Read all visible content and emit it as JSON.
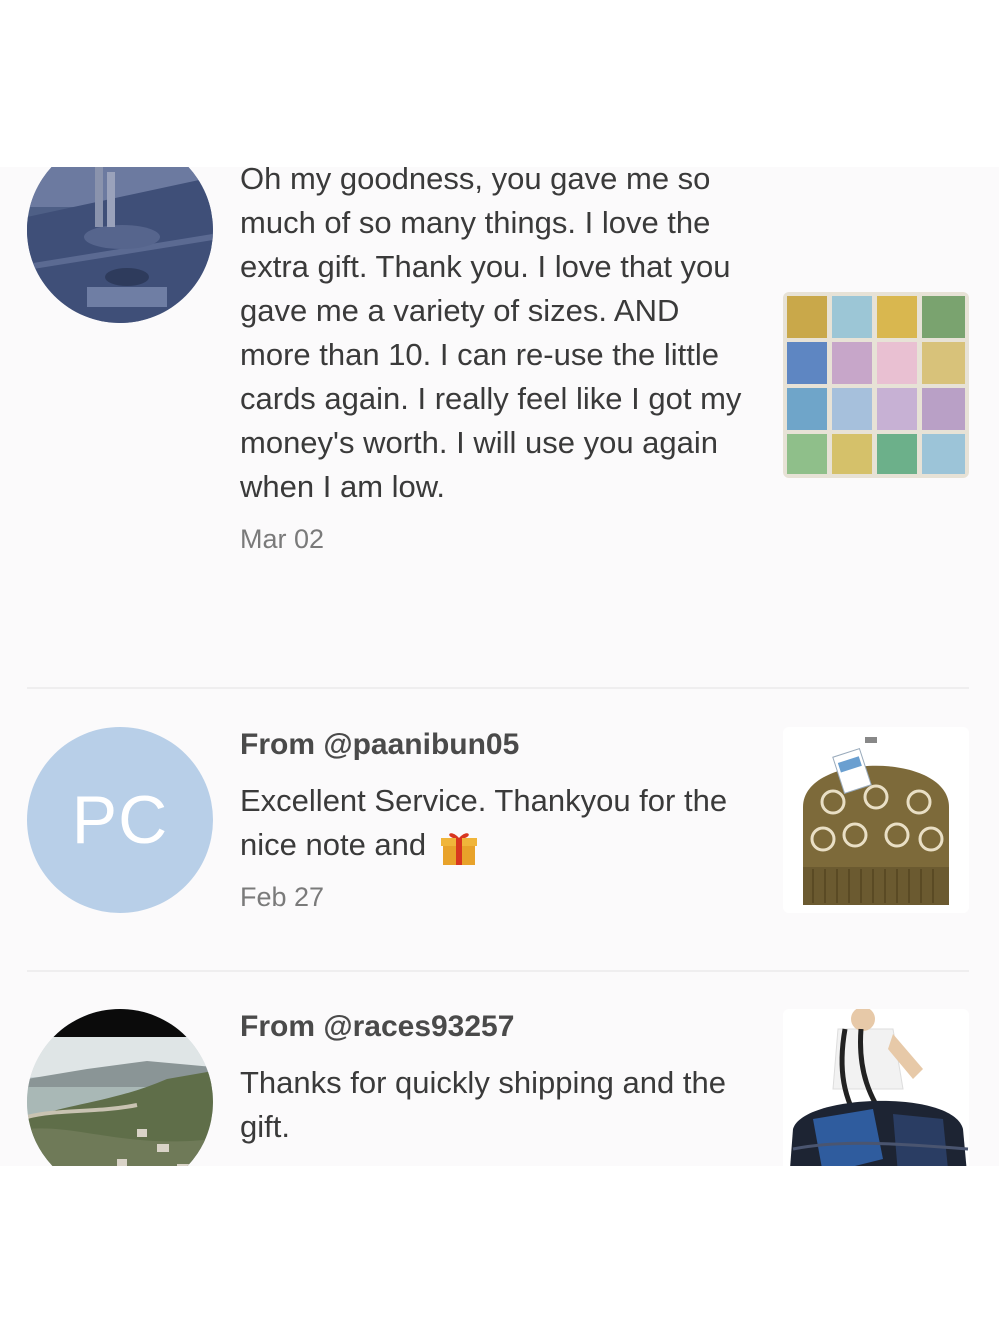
{
  "reviews": [
    {
      "text": "Oh my goodness, you gave me so much of so many things. I love the extra gift. Thank you. I love that you gave me a variety of sizes. AND more than 10. I can re-use the little cards again. I really feel like I got my money's worth. I will use you again when I am low.",
      "date": "Mar 02",
      "avatar_icon": "photo-avatar-icon",
      "thumb_icon": "gift-bags-thumbnail"
    },
    {
      "from": "From @paanibun05",
      "text": "Excellent Service. Thankyou for the nice note and",
      "emoji": "gift-emoji-icon",
      "date": "Feb 27",
      "initials": "PC",
      "thumb_icon": "knit-beanie-thumbnail"
    },
    {
      "from": "From @races93257",
      "text": "Thanks for quickly shipping and the gift.",
      "avatar_icon": "landscape-avatar-icon",
      "thumb_icon": "duffel-bag-thumbnail"
    }
  ],
  "colors": {
    "initials_avatar": "#b8cfe8",
    "divider": "#efeeef",
    "page_background": "#fbfafb"
  }
}
